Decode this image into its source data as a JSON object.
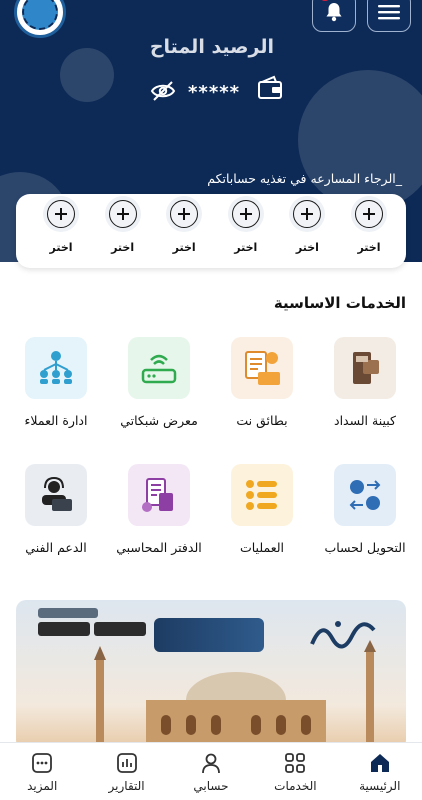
{
  "header": {
    "balance_title": "الرصيد المتاح",
    "balance_masked": "*****",
    "notice": "الرجاء المسارعه في تغذيه حساباتكم_"
  },
  "colors": {
    "header_bg": "#0d2a56",
    "accent": "#0d2a56",
    "notification_dot": "#e0203a"
  },
  "quick_slots": [
    {
      "label": "اختر",
      "icon": "plus-circle-icon"
    },
    {
      "label": "اختر",
      "icon": "plus-circle-icon"
    },
    {
      "label": "اختر",
      "icon": "plus-circle-icon"
    },
    {
      "label": "اختر",
      "icon": "plus-circle-icon"
    },
    {
      "label": "اختر",
      "icon": "plus-circle-icon"
    },
    {
      "label": "اختر",
      "icon": "plus-circle-icon"
    }
  ],
  "services": {
    "title": "الخدمات الاساسية",
    "items": [
      {
        "label": "كبينة السداد",
        "icon": "payment-cabinet-icon"
      },
      {
        "label": "بطائق نت",
        "icon": "net-cards-icon"
      },
      {
        "label": "معرض شبكاتي",
        "icon": "router-icon"
      },
      {
        "label": "ادارة العملاء",
        "icon": "customers-network-icon"
      },
      {
        "label": "التحويل لحساب",
        "icon": "transfer-icon"
      },
      {
        "label": "العمليات",
        "icon": "operations-list-icon"
      },
      {
        "label": "الدفتر المحاسبي",
        "icon": "accounting-book-icon"
      },
      {
        "label": "الدعم الفني",
        "icon": "support-agent-icon"
      }
    ]
  },
  "bottom_nav": [
    {
      "label": "الرئيسية",
      "icon": "home-icon",
      "active": true
    },
    {
      "label": "الخدمات",
      "icon": "grid-icon",
      "active": false
    },
    {
      "label": "حسابي",
      "icon": "user-icon",
      "active": false
    },
    {
      "label": "التقارير",
      "icon": "reports-icon",
      "active": false
    },
    {
      "label": "المزيد",
      "icon": "more-icon",
      "active": false
    }
  ]
}
